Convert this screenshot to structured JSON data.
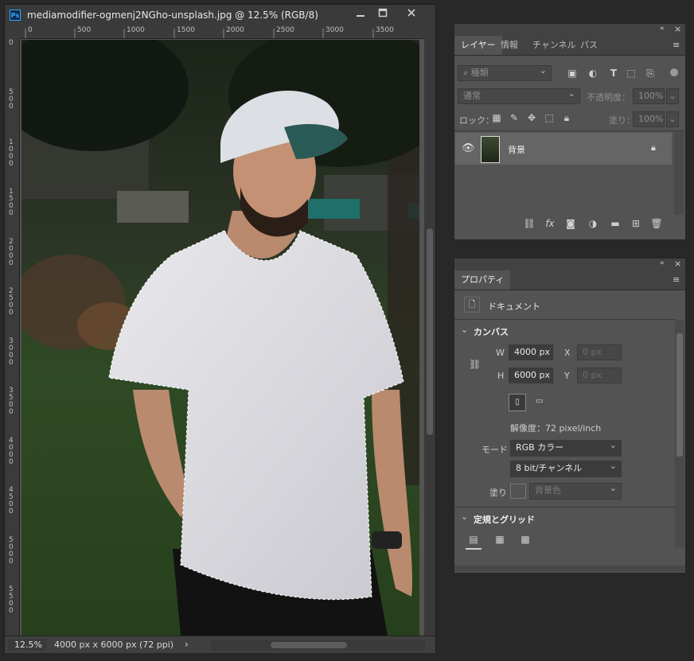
{
  "document": {
    "title": "mediamodifier-ogmenj2NGho-unsplash.jpg @ 12.5% (RGB/8)",
    "app_icon": "Ps",
    "ruler_h": [
      "0",
      "500",
      "1000",
      "1500",
      "2000",
      "2500",
      "3000",
      "3500"
    ],
    "ruler_v": [
      "0",
      "500",
      "1000",
      "1500",
      "2000",
      "2500",
      "3000",
      "3500",
      "4000",
      "4500",
      "5000",
      "5500"
    ],
    "zoom": "12.5%",
    "doc_info": "4000 px x 6000 px (72 ppi)",
    "status_arrow": "›",
    "window_buttons": [
      "minimize-icon",
      "maximize-icon",
      "close-icon"
    ]
  },
  "layers_panel": {
    "tabs": [
      "レイヤー",
      "情報",
      "チャンネル",
      "パス"
    ],
    "filter_placeholder": "種類",
    "blend_mode": "通常",
    "opacity_label": "不透明度：",
    "opacity_value": "100%",
    "lock_label": "ロック：",
    "fill_label": "塗り：",
    "fill_value": "100%",
    "layers": [
      {
        "name": "背景",
        "visible": true,
        "locked": true
      }
    ]
  },
  "properties_panel": {
    "tab": "プロパティ",
    "doc_label": "ドキュメント",
    "canvas_section": "カンバス",
    "w_label": "W",
    "w_value": "4000 px",
    "h_label": "H",
    "h_value": "6000 px",
    "x_label": "X",
    "x_placeholder": "0 px",
    "y_label": "Y",
    "y_placeholder": "0 px",
    "resolution": "解像度：72 pixel/inch",
    "mode_label": "モード",
    "mode_value": "RGB カラー",
    "bit_value": "8 bit/チャンネル",
    "fill_label": "塗り",
    "fill_value": "背景色",
    "rulers_section": "定規とグリッド"
  },
  "colors": {
    "accent": "#31a8ff",
    "panel": "#535353",
    "header": "#424242",
    "background": "#282828"
  }
}
